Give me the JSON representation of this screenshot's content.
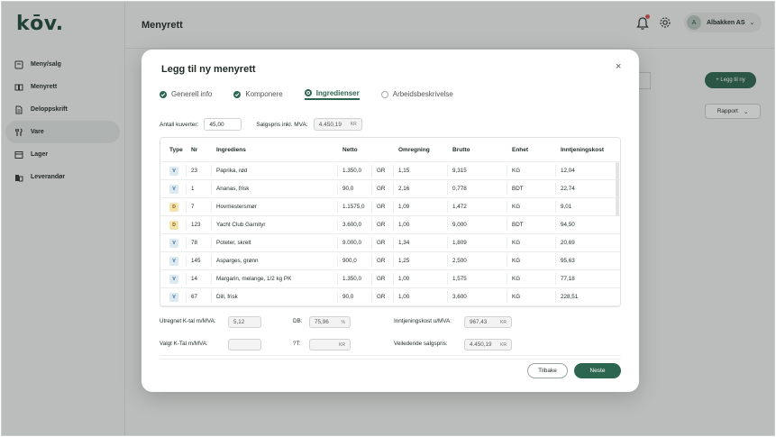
{
  "app": {
    "logo": "kōv."
  },
  "sidebar": {
    "items": [
      {
        "label": "Meny/salg",
        "icon": "scale-icon"
      },
      {
        "label": "Menyrett",
        "icon": "book-open-icon"
      },
      {
        "label": "Deloppskrift",
        "icon": "document-icon"
      },
      {
        "label": "Vare",
        "icon": "cutlery-icon",
        "active": true
      },
      {
        "label": "Lager",
        "icon": "warehouse-icon"
      },
      {
        "label": "Leverandør",
        "icon": "building-icon"
      }
    ]
  },
  "header": {
    "title": "Menyrett",
    "user": {
      "initial": "A",
      "name": "Albakken AS"
    }
  },
  "background": {
    "add_button": "+ Legg til ny",
    "report_button": "Rapport"
  },
  "modal": {
    "title": "Legg til ny menyrett",
    "close": "×",
    "steps": [
      {
        "label": "Generell info",
        "state": "done"
      },
      {
        "label": "Komponere",
        "state": "done"
      },
      {
        "label": "Ingredienser",
        "state": "current"
      },
      {
        "label": "Arbeidsbeskrivelse",
        "state": "todo"
      }
    ],
    "covers": {
      "label": "Antall kuverter:",
      "value": "45,00"
    },
    "price": {
      "label": "Salgspris inkl. MVA:",
      "value": "4.450,19",
      "unit": "KR"
    },
    "table": {
      "headers": [
        "Type",
        "Nr",
        "Ingrediens",
        "Netto",
        "Omregning",
        "Brutto",
        "Enhet",
        "Inntjeningskost"
      ],
      "rows": [
        {
          "type": "V",
          "nr": "23",
          "name": "Paprika, rød",
          "netto": "1.350,0",
          "unit": "GR",
          "omregning": "1,15",
          "brutto": "9,315",
          "enhet": "KG",
          "kost": "12,04"
        },
        {
          "type": "V",
          "nr": "1",
          "name": "Ananas, frisk",
          "netto": "90,0",
          "unit": "GR",
          "omregning": "2,16",
          "brutto": "0,778",
          "enhet": "BDT",
          "kost": "22,74"
        },
        {
          "type": "D",
          "nr": "7",
          "name": "Hovmestersmør",
          "netto": "1.1575,0",
          "unit": "GR",
          "omregning": "1,09",
          "brutto": "1,472",
          "enhet": "KG",
          "kost": "9,01"
        },
        {
          "type": "D",
          "nr": "123",
          "name": "Yacht Club Garnityr",
          "netto": "3.600,0",
          "unit": "GR",
          "omregning": "1,00",
          "brutto": "9,000",
          "enhet": "BDT",
          "kost": "94,50"
        },
        {
          "type": "V",
          "nr": "78",
          "name": "Poteter, skrelt",
          "netto": "9.000,0",
          "unit": "GR",
          "omregning": "1,34",
          "brutto": "1,809",
          "enhet": "KG",
          "kost": "20,69"
        },
        {
          "type": "V",
          "nr": "145",
          "name": "Asparges, grønn",
          "netto": "900,0",
          "unit": "GR",
          "omregning": "1,25",
          "brutto": "2,500",
          "enhet": "KG",
          "kost": "95,63"
        },
        {
          "type": "V",
          "nr": "14",
          "name": "Margarin, melange, 1/2 kg PK",
          "netto": "1.350,0",
          "unit": "GR",
          "omregning": "1,00",
          "brutto": "1,575",
          "enhet": "KG",
          "kost": "77,18"
        },
        {
          "type": "V",
          "nr": "67",
          "name": "Dill, frisk",
          "netto": "90,0",
          "unit": "GR",
          "omregning": "1,00",
          "brutto": "3,600",
          "enhet": "KG",
          "kost": "228,51"
        }
      ]
    },
    "summary": {
      "ktal_calc": {
        "label": "Utregnet K-tal m/MVA:",
        "value": "5,12"
      },
      "db": {
        "label": "DB:",
        "value": "75,96",
        "unit": "%"
      },
      "cost": {
        "label": "Inntjeningskost u/MVA:",
        "value": "967,43",
        "unit": "KR"
      },
      "ktal_sel": {
        "label": "Valgt K-Tal m/MVA:",
        "value": ""
      },
      "tt": {
        "label": "?T:",
        "value": "",
        "unit": "KR"
      },
      "guide_price": {
        "label": "Veiledende salgspris:",
        "value": "4.450,19",
        "unit": "KR"
      }
    },
    "back_button": "Tilbake",
    "next_button": "Neste"
  }
}
